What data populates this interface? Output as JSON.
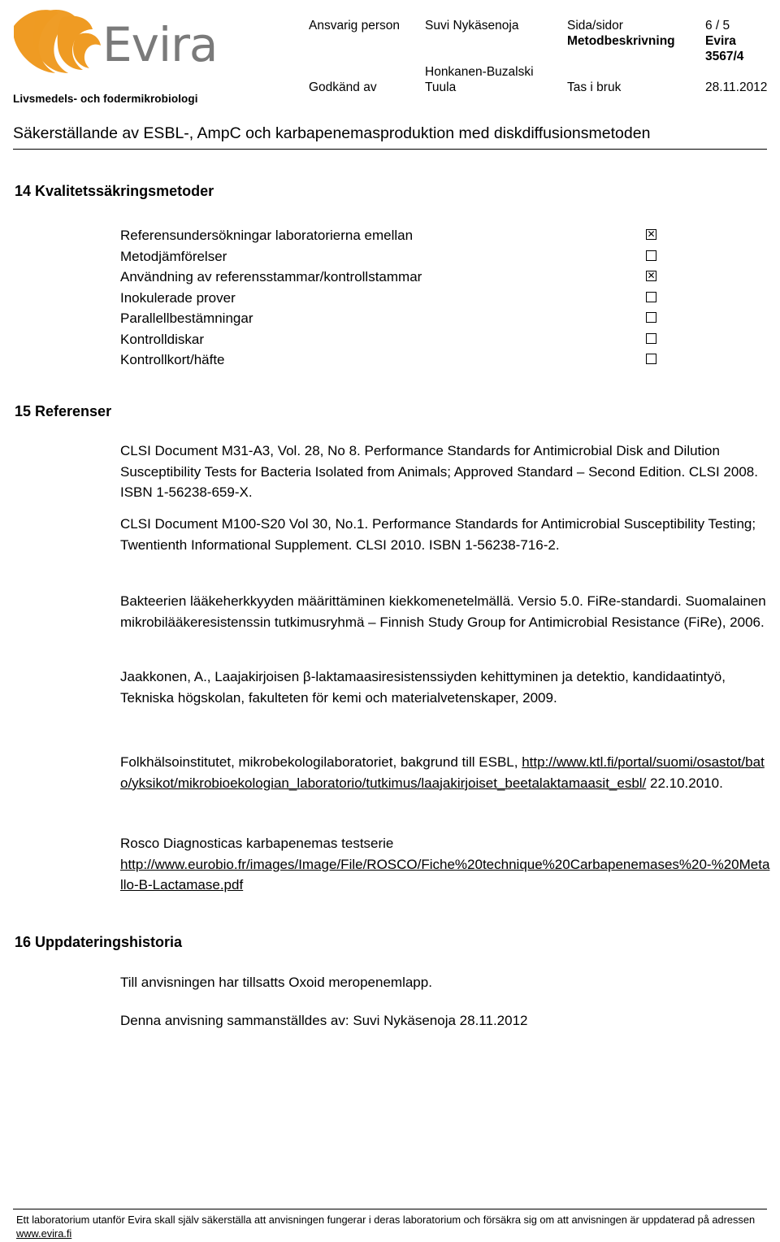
{
  "header": {
    "org_name": "Evira",
    "department": "Livsmedels- och fodermikrobiologi",
    "meta": {
      "responsible_person_label": "Ansvarig person",
      "responsible_person_value": "Suvi Nykäsenoja",
      "page_label": "Sida/sidor",
      "page_value": "6 / 5",
      "method_label": "Metodbeskrivning",
      "method_value": "Evira 3567/4",
      "approved_by_label": "Godkänd av",
      "approved_by_value_line1": "Honkanen-Buzalski",
      "approved_by_value_line2": "Tuula",
      "in_use_label": "Tas i bruk",
      "in_use_value": "28.11.2012"
    }
  },
  "document": {
    "title": "Säkerställande av ESBL-, AmpC och karbapenemasproduktion med diskdiffusionsmetoden"
  },
  "sections": {
    "quality": {
      "heading": "14 Kvalitetssäkringsmetoder",
      "items": [
        {
          "label": "Referensundersökningar laboratorierna emellan",
          "checked": true,
          "mark": "✕"
        },
        {
          "label": "Metodjämförelser",
          "checked": false,
          "mark": ""
        },
        {
          "label": "Användning av referensstammar/kontrollstammar",
          "checked": true,
          "mark": "✕"
        },
        {
          "label": "Inokulerade prover",
          "checked": false,
          "mark": ""
        },
        {
          "label": "Parallellbestämningar",
          "checked": false,
          "mark": ""
        },
        {
          "label": "Kontrolldiskar",
          "checked": false,
          "mark": ""
        },
        {
          "label": "Kontrollkort/häfte",
          "checked": false,
          "mark": ""
        }
      ]
    },
    "references": {
      "heading": "15 Referenser",
      "entries": [
        {
          "text": "CLSI Document M31-A3, Vol. 28, No 8. Performance Standards for Antimicrobial Disk and Dilution Susceptibility Tests for Bacteria Isolated from Animals; Approved Standard – Second Edition. CLSI 2008. ISBN 1-56238-659-X."
        },
        {
          "text": "CLSI Document M100-S20 Vol 30, No.1. Performance Standards for Antimicrobial Susceptibility Testing; Twentienth Informational Supplement. CLSI 2010. ISBN 1-56238-716-2."
        },
        {
          "text": "Bakteerien lääkeherkkyyden määrittäminen kiekkomenetelmällä. Versio 5.0. FiRe-standardi. Suomalainen mikrobilääkeresistenssin tutkimusryhmä – Finnish Study Group for Antimicrobial Resistance (FiRe), 2006."
        },
        {
          "text": "Jaakkonen, A., Laajakirjoisen β-laktamaasiresistenssiyden kehittyminen ja detektio, kandidaatintyö, Tekniska högskolan, fakulteten för kemi och materialvetenskaper, 2009."
        }
      ],
      "link_entries": [
        {
          "intro": "Folkhälsoinstitutet, mikrobekologilaboratoriet, bakgrund till ESBL,",
          "url": "http://www.ktl.fi/portal/suomi/osastot/bato/yksikot/mikrobioekologian_laboratorio/tutkimus/laajakirjoiset_beetalaktamaasit_esbl/",
          "trailing": " 22.10.2010."
        },
        {
          "intro": "Rosco Diagnosticas karbapenemas testserie",
          "url": "http://www.eurobio.fr/images/Image/File/ROSCO/Fiche%20technique%20Carbapenemases%20-%20Metallo-B-Lactamase.pdf",
          "trailing": ""
        }
      ]
    },
    "history": {
      "heading": "16 Uppdateringshistoria",
      "entries": [
        "Till anvisningen har tillsatts Oxoid meropenemlapp.",
        "Denna anvisning sammanställdes av: Suvi Nykäsenoja 28.11.2012"
      ]
    }
  },
  "footer": {
    "text_before_link": "Ett laboratorium utanför Evira skall själv säkerställa att anvisningen fungerar i deras laboratorium och försäkra sig om att anvisningen är uppdaterad på adressen ",
    "link": "www.evira.fi"
  },
  "colors": {
    "logo_orange": "#ef9b23",
    "logo_gray": "#7a7a7a",
    "text": "#000000",
    "background": "#ffffff"
  }
}
